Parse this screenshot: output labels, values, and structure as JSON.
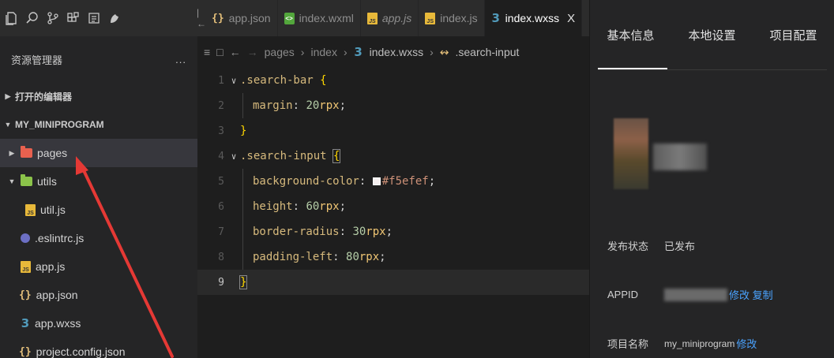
{
  "toolbar": {
    "icons": [
      "files-icon",
      "search-icon",
      "source-control-icon",
      "extensions-icon",
      "outline-icon",
      "debug-icon"
    ]
  },
  "tabs": [
    {
      "label": "app.json",
      "icon": "json-icon",
      "active": false
    },
    {
      "label": "index.wxml",
      "icon": "wxml-icon",
      "active": false
    },
    {
      "label": "app.js",
      "icon": "js-icon",
      "active": false
    },
    {
      "label": "index.js",
      "icon": "js-icon",
      "active": false
    },
    {
      "label": "index.wxss",
      "icon": "wxss-icon",
      "active": true,
      "close": "X"
    }
  ],
  "sidebar": {
    "title": "资源管理器",
    "more": "...",
    "open_editors": "打开的编辑器",
    "project": "MY_MINIPROGRAM",
    "items": [
      {
        "label": "pages",
        "icon": "folder-pages-icon",
        "selected": true
      },
      {
        "label": "utils",
        "icon": "folder-utils-icon"
      },
      {
        "label": "util.js",
        "icon": "js-icon"
      },
      {
        "label": ".eslintrc.js",
        "icon": "eslint-icon"
      },
      {
        "label": "app.js",
        "icon": "js-icon"
      },
      {
        "label": "app.json",
        "icon": "json-icon"
      },
      {
        "label": "app.wxss",
        "icon": "wxss-icon"
      },
      {
        "label": "project.config.json",
        "icon": "json-icon"
      }
    ]
  },
  "breadcrumb": {
    "parts": [
      "pages",
      "index",
      "index.wxss",
      ".search-input"
    ]
  },
  "code": {
    "lines": [
      {
        "n": "1",
        "sel": ".search-bar",
        "brace": "{"
      },
      {
        "n": "2",
        "prop": "margin",
        "num": "20",
        "unit": "rpx"
      },
      {
        "n": "3",
        "brace": "}"
      },
      {
        "n": "4",
        "sel": ".search-input",
        "brace": "{"
      },
      {
        "n": "5",
        "prop": "background-color",
        "hex": "#f5efef"
      },
      {
        "n": "6",
        "prop": "height",
        "num": "60",
        "unit": "rpx"
      },
      {
        "n": "7",
        "prop": "border-radius",
        "num": "30",
        "unit": "rpx"
      },
      {
        "n": "8",
        "prop": "padding-left",
        "num": "80",
        "unit": "rpx"
      },
      {
        "n": "9",
        "brace": "}"
      }
    ]
  },
  "right_panel": {
    "tabs": [
      "基本信息",
      "本地设置",
      "项目配置"
    ],
    "status_label": "发布状态",
    "status_value": "已发布",
    "appid_label": "APPID",
    "appid_actions": "修改 复制",
    "name_label": "项目名称",
    "name_value": "my_miniprogram",
    "name_action": "修改"
  },
  "colors": {
    "accent": "#4aa3ff",
    "arrow": "#e53935",
    "folder_pages": "#e8614f",
    "folder_utils": "#8bc34a"
  }
}
